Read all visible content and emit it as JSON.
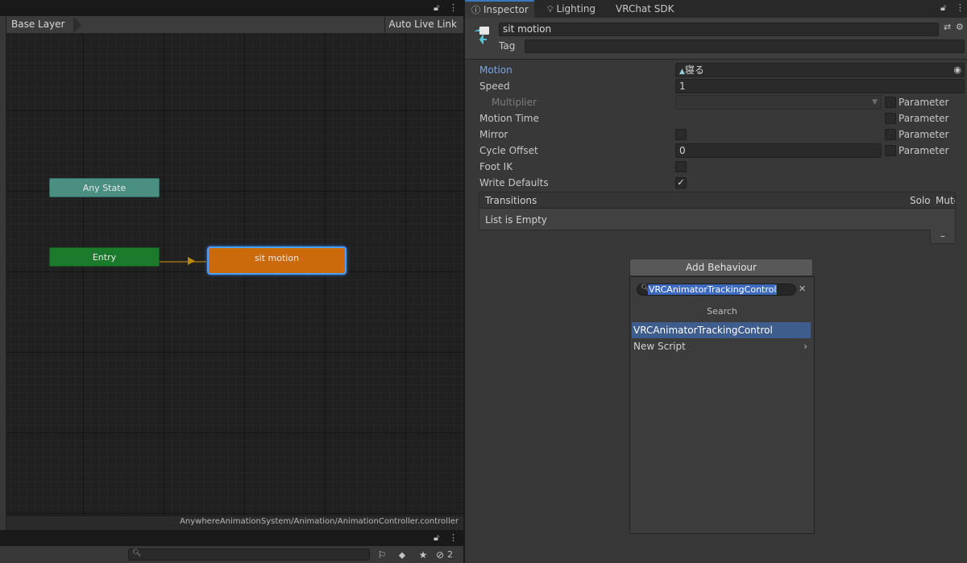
{
  "animator": {
    "breadcrumb": "Base Layer",
    "auto_live_link": "Auto Live Link",
    "nodes": {
      "any_state": "Any State",
      "entry": "Entry",
      "sit_motion": "sit motion"
    },
    "controller_path": "AnywhereAnimationSystem/Animation/AnimationController.controller"
  },
  "project": {
    "search_placeholder": "",
    "hidden_count": "2"
  },
  "inspector": {
    "tabs": {
      "inspector": "Inspector",
      "lighting": "Lighting",
      "vrchat_sdk": "VRChat SDK"
    },
    "state_name": "sit motion",
    "tag_label": "Tag",
    "tag_value": "",
    "motion_label": "Motion",
    "motion_value": "寝る",
    "speed_label": "Speed",
    "speed_value": "1",
    "multiplier_label": "Multiplier",
    "motion_time_label": "Motion Time",
    "mirror_label": "Mirror",
    "cycle_offset_label": "Cycle Offset",
    "cycle_offset_value": "0",
    "foot_ik_label": "Foot IK",
    "write_defaults_label": "Write Defaults",
    "write_defaults_checked": "✓",
    "parameter_label": "Parameter",
    "transitions": {
      "header": "Transitions",
      "solo": "Solo",
      "mute": "Mute",
      "empty": "List is Empty",
      "remove": "–"
    },
    "add_behaviour": "Add Behaviour",
    "popup": {
      "query": "VRCAnimatorTrackingControl",
      "title": "Search",
      "items": [
        "VRCAnimatorTrackingControl",
        "New Script"
      ]
    }
  },
  "colors": {
    "accent": "#3a79bb",
    "motion_label": "#7ba7e0",
    "state_node": "#cb6a0a",
    "entry_node": "#1c7a2c",
    "any_state_node": "#4a8f82",
    "selection": "#3e5c8c"
  },
  "icons": [
    "lock-icon",
    "menu-icon",
    "info-icon",
    "lightbulb-icon",
    "preset-icon",
    "gear-icon",
    "object-picker-icon",
    "dropdown-icon",
    "search-icon",
    "close-icon",
    "chevron-right-icon",
    "eye-hidden-icon",
    "star-icon",
    "tag-icon",
    "filter-icon"
  ]
}
